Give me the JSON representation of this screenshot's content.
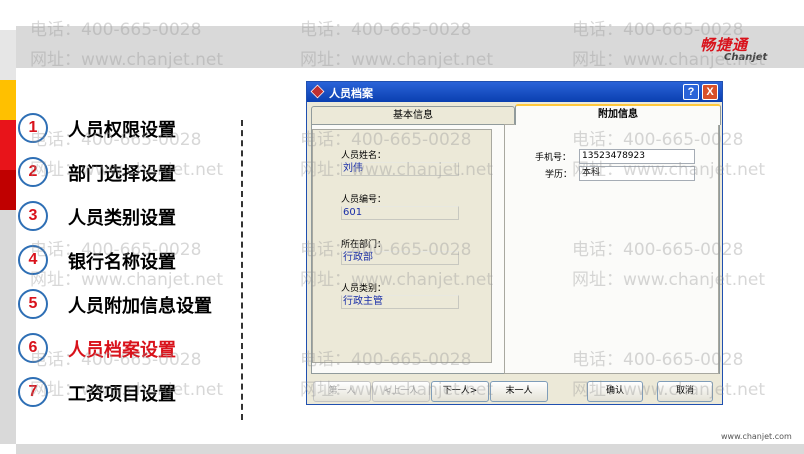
{
  "watermark": {
    "phone": "电话：400-665-0028",
    "site": "网址：www.chanjet.net"
  },
  "brand": {
    "name_cn": "畅捷通",
    "name_en": "Chanjet",
    "footer_url": "www.chanjet.com"
  },
  "colors": {
    "accent_red": "#d9121b",
    "circle_border": "#2e6fb5",
    "titlebar_blue": "#0a3fb0"
  },
  "menu": {
    "items": [
      {
        "num": "1",
        "label": "人员权限设置",
        "active": false
      },
      {
        "num": "2",
        "label": "部门选择设置",
        "active": false
      },
      {
        "num": "3",
        "label": "人员类别设置",
        "active": false
      },
      {
        "num": "4",
        "label": "银行名称设置",
        "active": false
      },
      {
        "num": "5",
        "label": "人员附加信息设置",
        "active": false
      },
      {
        "num": "6",
        "label": "人员档案设置",
        "active": true
      },
      {
        "num": "7",
        "label": "工资项目设置",
        "active": false
      }
    ]
  },
  "dialog": {
    "title": "人员档案",
    "help_label": "?",
    "close_label": "X",
    "tabs": [
      {
        "label": "基本信息",
        "active": false
      },
      {
        "label": "附加信息",
        "active": true
      }
    ],
    "fields_left": {
      "name_label": "人员姓名：",
      "name_value": "刘伟",
      "id_label": "人员编号：",
      "id_value": "601",
      "dept_label": "所在部门：",
      "dept_value": "行政部",
      "type_label": "人员类别：",
      "type_value": "行政主管"
    },
    "fields_right": {
      "phone_label": "手机号：",
      "phone_value": "13523478923",
      "edu_label": "学历：",
      "edu_value": "本科"
    },
    "buttons": {
      "first": "第一人",
      "prev": "<上一人",
      "next": "下一人>",
      "last": "末一人",
      "ok": "确认",
      "cancel": "取消"
    }
  }
}
